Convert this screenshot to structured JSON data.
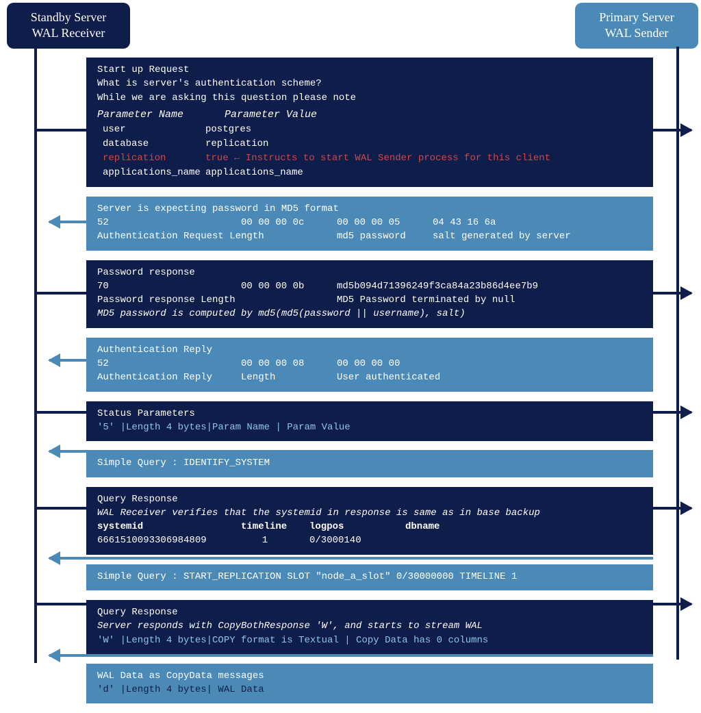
{
  "standby": {
    "line1": "Standby Server",
    "line2": "WAL Receiver"
  },
  "primary": {
    "line1": "Primary Server",
    "line2": "WAL Sender"
  },
  "msg1": {
    "title": "Start up Request",
    "line2": "What is server's authentication scheme?",
    "line3": "While we are asking this question please note",
    "pname_h": "Parameter Name",
    "pval_h": "Parameter Value",
    "params": {
      "user_k": "user",
      "user_v": "postgres",
      "db_k": "database",
      "db_v": "replication",
      "rep_k": "replication",
      "rep_v": "true ← Instructs to start WAL Sender process for this client",
      "app_k": "applications_name",
      "app_v": "applications_name"
    }
  },
  "msg2": {
    "title": "Server is expecting password in MD5 format",
    "c1a": "52",
    "c2a": "00 00 00 0c",
    "c3a": "00 00 00 05",
    "c4a": "04 43 16 6a",
    "c1b": "Authentication Request Length",
    "c2b": "",
    "c3b": "md5 password",
    "c4b": "salt generated by server"
  },
  "msg3": {
    "title": "Password response",
    "c1a": "70",
    "c2a": "00 00 00 0b",
    "c3a": "md5b094d71396249f3ca84a23b86d4ee7b9",
    "c1b": "Password response Length",
    "c2b": "",
    "c3b": "MD5 Password terminated by null",
    "note": "MD5 password is computed by md5(md5(password || username), salt)"
  },
  "msg4": {
    "title": "Authentication Reply",
    "c1a": "52",
    "c2a": "00 00 00 08",
    "c3a": "00 00 00 00",
    "c1b": "Authentication Reply",
    "c2b": "Length",
    "c3b": "User authenticated"
  },
  "msg5": {
    "title": "Status Parameters",
    "detail": "'5' |Length 4 bytes|Param Name | Param Value"
  },
  "msg6": {
    "text": "Simple Query : IDENTIFY_SYSTEM"
  },
  "msg7": {
    "title": "Query Response",
    "note": "WAL Receiver verifies that the systemid in response is same as in base backup",
    "h1": "systemid",
    "h2": "timeline",
    "h3": "logpos",
    "h4": "dbname",
    "v1": "6661510093306984809",
    "v2": "1",
    "v3": "0/3000140",
    "v4": ""
  },
  "msg8": {
    "text": "Simple Query : START_REPLICATION SLOT \"node_a_slot\" 0/30000000 TIMELINE 1"
  },
  "msg9": {
    "title": "Query Response",
    "note": "Server responds with CopyBothResponse 'W', and starts to stream WAL",
    "detail": "'W' |Length 4 bytes|COPY format is Textual | Copy Data has 0 columns"
  },
  "msg10": {
    "title": "WAL Data as CopyData messages",
    "detail": "'d' |Length 4 bytes| WAL Data"
  }
}
